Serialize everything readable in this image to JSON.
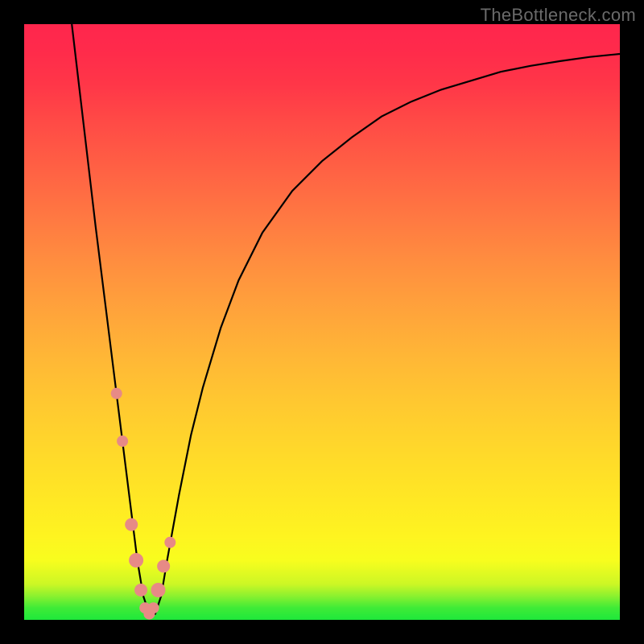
{
  "watermark": "TheBottleneck.com",
  "colors": {
    "frame_bg": "#000000",
    "curve_stroke": "#000000",
    "marker_fill": "#e78a86",
    "gradient_top": "#FF264D",
    "gradient_bottom": "#1EE83B"
  },
  "chart_data": {
    "type": "line",
    "title": "",
    "xlabel": "",
    "ylabel": "",
    "xlim": [
      0,
      100
    ],
    "ylim": [
      0,
      100
    ],
    "series": [
      {
        "name": "bottleneck-curve",
        "x": [
          8,
          10,
          12,
          14,
          15,
          16,
          17,
          18,
          19,
          20,
          21,
          22,
          23,
          24,
          26,
          28,
          30,
          33,
          36,
          40,
          45,
          50,
          55,
          60,
          65,
          70,
          75,
          80,
          85,
          90,
          95,
          100
        ],
        "values": [
          100,
          83,
          66,
          50,
          42,
          34,
          26,
          18,
          10,
          4,
          1,
          1,
          4,
          10,
          21,
          31,
          39,
          49,
          57,
          65,
          72,
          77,
          81,
          84.5,
          87,
          89,
          90.5,
          92,
          93,
          93.8,
          94.5,
          95
        ]
      }
    ],
    "markers": {
      "name": "highlighted-points",
      "x": [
        15.5,
        16.5,
        18.0,
        18.8,
        19.6,
        20.3,
        21.0,
        21.7,
        22.5,
        23.4,
        24.5
      ],
      "values": [
        38,
        30,
        16,
        10,
        5,
        2,
        1,
        2,
        5,
        9,
        13
      ],
      "radius": [
        7,
        7,
        8,
        9,
        8,
        7,
        7,
        7,
        9,
        8,
        7
      ]
    }
  }
}
